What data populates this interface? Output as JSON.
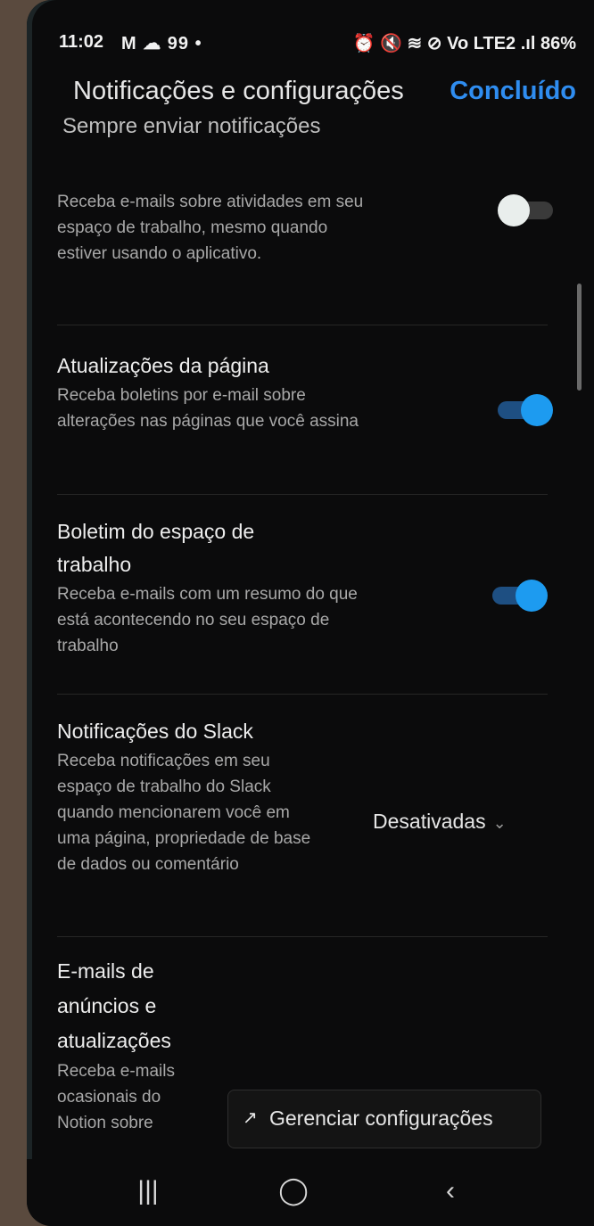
{
  "status_bar": {
    "time": "11:02",
    "left_icons": "M ☁ 99 •",
    "battery": "86%",
    "right_icons": "⏰ 🔇 ≋ ⊘ Vo LTE2 .ıl"
  },
  "header": {
    "title": "Notificações e configurações",
    "done_label": "Concluído"
  },
  "section_cut": "Sempre enviar notificações",
  "items": [
    {
      "title": "",
      "description": "Receba e-mails sobre atividades em seu espaço de trabalho, mesmo quando estiver usando o aplicativo.",
      "toggle": "off"
    },
    {
      "title": "Atualizações da página",
      "description": "Receba boletins por e-mail sobre alterações nas páginas que você assina",
      "toggle": "on"
    },
    {
      "title": "Boletim do espaço de trabalho",
      "description": "Receba e-mails com um resumo do que está acontecendo no seu espaço de trabalho",
      "toggle": "on"
    },
    {
      "title": "Notificações do Slack",
      "description": "Receba notificações em seu espaço de trabalho do Slack quando mencionarem você em uma página, propriedade de base de dados ou comentário",
      "dropdown_value": "Desativadas"
    },
    {
      "title": "E-mails de anúncios e atualizações",
      "description": "Receba e-mails ocasionais do Notion sobre"
    }
  ],
  "manage_button": {
    "arrow": "↗",
    "label": "Gerenciar configurações"
  },
  "nav_bar": {
    "recent": "|||",
    "home": "◯",
    "back": "‹"
  },
  "colors": {
    "accent": "#2f8df0",
    "toggle_on": "#1d9bf0",
    "background": "#0b0b0c"
  }
}
